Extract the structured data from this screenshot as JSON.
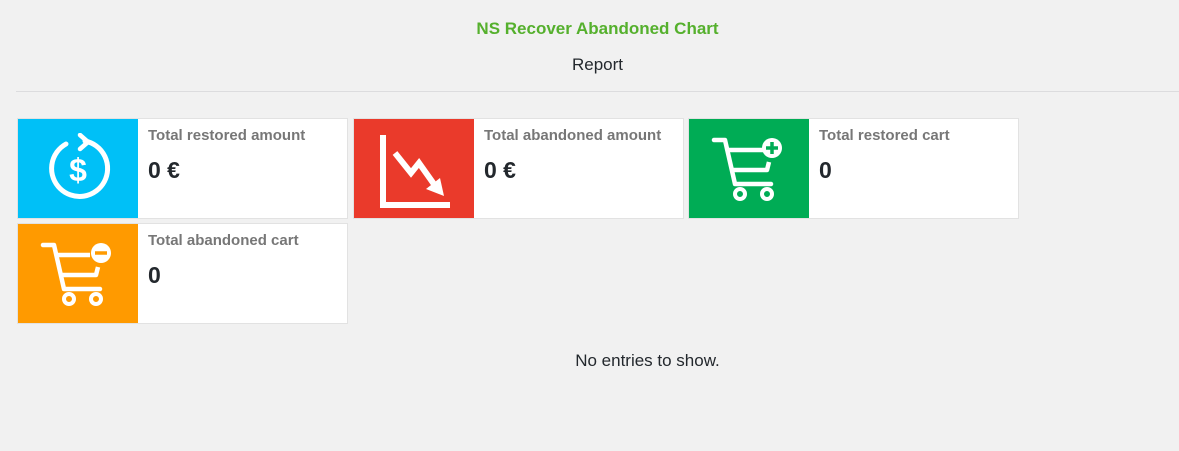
{
  "header": {
    "title": "NS Recover Abandoned Chart",
    "subtitle": "Report"
  },
  "cards": [
    {
      "label": "Total restored amount",
      "value": "0 €",
      "icon": "restore-dollar-icon",
      "color": "#00c0f7"
    },
    {
      "label": "Total abandoned amount",
      "value": "0 €",
      "icon": "trend-down-chart-icon",
      "color": "#ea3a2b"
    },
    {
      "label": "Total restored cart",
      "value": "0",
      "icon": "cart-plus-icon",
      "color": "#00ac55"
    },
    {
      "label": "Total abandoned cart",
      "value": "0",
      "icon": "cart-minus-icon",
      "color": "#ff9a00"
    }
  ],
  "table": {
    "empty_message": "No entries to show."
  }
}
